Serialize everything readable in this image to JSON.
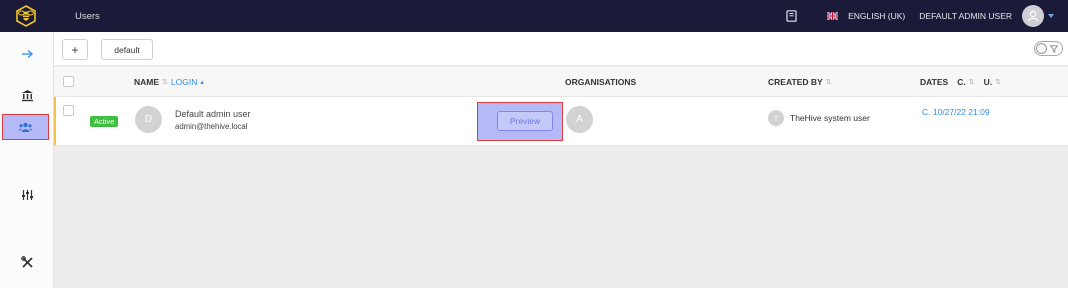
{
  "topbar": {
    "page_title": "Users",
    "language": "ENGLISH (UK)",
    "user_name": "DEFAULT ADMIN USER"
  },
  "toolbar": {
    "add_label": "+",
    "filter_label": "default"
  },
  "table": {
    "columns": {
      "name": "NAME",
      "login": "LOGIN",
      "organisations": "ORGANISATIONS",
      "created_by": "CREATED BY",
      "dates": "DATES",
      "created_short": "C.",
      "updated_short": "U."
    },
    "rows": [
      {
        "status": "Active",
        "avatar_letter": "D",
        "name": "Default admin user",
        "login": "admin@thehive.local",
        "preview_label": "Preview",
        "org_letter": "A",
        "creator_letter": "T",
        "created_by": "TheHive system user",
        "date": "C. 10/27/22 21:09"
      }
    ]
  },
  "colors": {
    "topbar_bg": "#1b1a38",
    "link": "#2f8fe6",
    "active_badge": "#3fbf3f",
    "highlight": "#b5baf7",
    "highlight_border": "#e23b3b",
    "row_accent": "#f2c14e"
  },
  "icons": {
    "logo": "bee-logo-icon",
    "docs": "book-icon",
    "flag": "uk-flag-icon",
    "nav": [
      "arrow-right-icon",
      "bank-icon",
      "users-icon",
      "sliders-icon",
      "tools-icon"
    ]
  }
}
